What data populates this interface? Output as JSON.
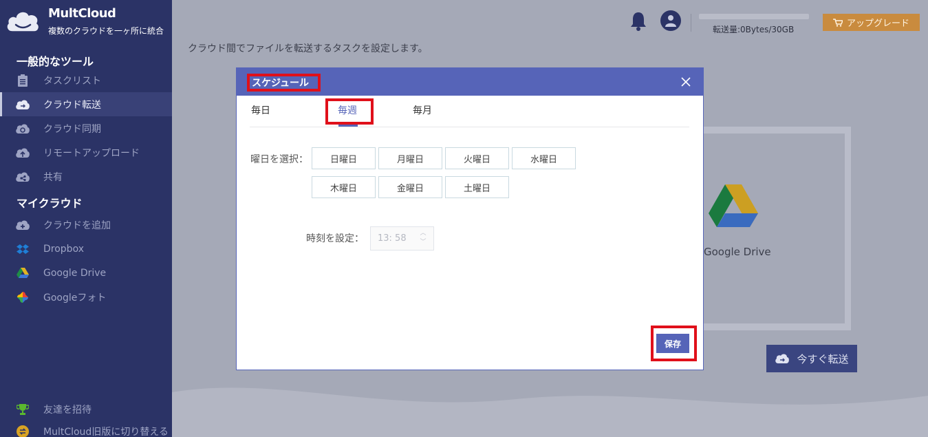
{
  "brand": {
    "name": "MultCloud",
    "tagline": "複数のクラウドを一ヶ所に統合"
  },
  "sidebar": {
    "section_tools": "一般的なツール",
    "tools": [
      {
        "label": "タスクリスト",
        "icon": "clipboard-icon"
      },
      {
        "label": "クラウド転送",
        "icon": "cloud-transfer-icon",
        "active": true
      },
      {
        "label": "クラウド同期",
        "icon": "cloud-sync-icon"
      },
      {
        "label": "リモートアップロード",
        "icon": "cloud-upload-icon"
      },
      {
        "label": "共有",
        "icon": "share-icon"
      }
    ],
    "section_clouds": "マイクラウド",
    "clouds": [
      {
        "label": "クラウドを追加",
        "icon": "add-cloud-icon"
      },
      {
        "label": "Dropbox",
        "icon": "dropbox-icon"
      },
      {
        "label": "Google Drive",
        "icon": "google-drive-icon"
      },
      {
        "label": "Googleフォト",
        "icon": "google-photos-icon"
      }
    ],
    "bottom": [
      {
        "label": "友達を招待",
        "icon": "trophy-icon"
      },
      {
        "label": "MultCloud旧版に切り替える",
        "icon": "switch-icon"
      }
    ]
  },
  "main": {
    "description": "クラウド間でファイルを転送するタスクを設定します。",
    "quota_text": "転送量:0Bytes/30GB",
    "upgrade_label": "アップグレード",
    "target_label": "Google Drive",
    "transfer_now_label": "今すぐ転送"
  },
  "modal": {
    "title": "スケジュール",
    "tabs": [
      "毎日",
      "毎週",
      "毎月"
    ],
    "active_tab": "毎週",
    "weekday_label": "曜日を選択：",
    "days": [
      "日曜日",
      "月曜日",
      "火曜日",
      "水曜日",
      "木曜日",
      "金曜日",
      "土曜日"
    ],
    "time_label": "時刻を設定：",
    "time_value": "13: 58",
    "save_label": "保存"
  },
  "colors": {
    "sidebar": "#2b3366",
    "accent": "#5664b8",
    "highlight": "#e0101a",
    "upgrade": "#c98b3e"
  }
}
